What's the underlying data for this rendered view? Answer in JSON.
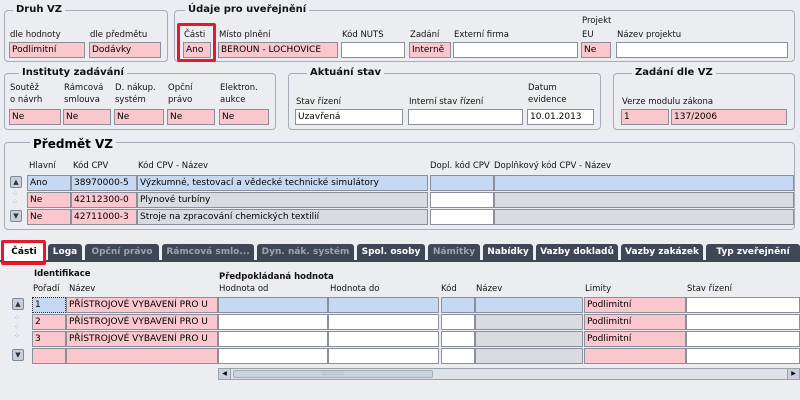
{
  "druh_vz": {
    "title": "Druh VZ",
    "dle_hodnoty_label": "dle hodnoty",
    "dle_hodnoty_value": "Podlimitní",
    "dle_predmetu_label": "dle předmětu",
    "dle_predmetu_value": "Dodávky"
  },
  "udaje": {
    "title": "Údaje pro uveřejnění",
    "casti_label": "Části",
    "casti_value": "Ano",
    "misto_label": "Místo plnění",
    "misto_value": "BEROUN - LOCHOVICE",
    "nuts_label": "Kód NUTS",
    "nuts_value": "",
    "zadani_label": "Zadání",
    "zadani_value": "Interně",
    "externi_label": "Externí firma",
    "externi_value": "",
    "projekt_label_1": "Projekt",
    "projekt_label_2": "EU",
    "projekt_value": "Ne",
    "nazev_label": "Název projektu",
    "nazev_value": ""
  },
  "instituty": {
    "title": "Instituty zadávání",
    "cols": [
      {
        "l1": "Soutěž",
        "l2": "o návrh",
        "value": "Ne"
      },
      {
        "l1": "Rámcová",
        "l2": "smlouva",
        "value": "Ne"
      },
      {
        "l1": "D. nákup.",
        "l2": "systém",
        "value": "Ne"
      },
      {
        "l1": "Opční",
        "l2": "právo",
        "value": "Ne"
      },
      {
        "l1": "Elektron.",
        "l2": "aukce",
        "value": "Ne"
      }
    ]
  },
  "aktualni": {
    "title": "Aktuání stav",
    "stav_label": "Stav řízení",
    "stav_value": "Uzavřená",
    "interni_label": "Interní stav řízení",
    "interni_value": "",
    "datum_label_1": "Datum",
    "datum_label_2": "evidence",
    "datum_value": "10.01.2013"
  },
  "zadani_dle_vz": {
    "title": "Zadání dle VZ",
    "verze_label": "Verze modulu zákona",
    "verze_num": "1",
    "verze_value": "137/2006"
  },
  "predmet": {
    "title": "Předmět VZ",
    "headers": {
      "hlavni": "Hlavní",
      "kod": "Kód CPV",
      "nazev": "Kód CPV - Název",
      "dopl_kod": "Dopl. kód CPV",
      "dopl_nazev": "Doplňkový kód CPV - Název"
    },
    "rows": [
      {
        "hlavni": "Ano",
        "kod": "38970000-5",
        "nazev": "Výzkumné, testovací a vědecké technické simulátory"
      },
      {
        "hlavni": "Ne",
        "kod": "42112300-0",
        "nazev": "Plynové turbíny"
      },
      {
        "hlavni": "Ne",
        "kod": "42711000-3",
        "nazev": "Stroje na zpracování chemických textilií"
      }
    ]
  },
  "tabs": [
    {
      "label": "Části",
      "state": "active"
    },
    {
      "label": "Loga",
      "state": "normal"
    },
    {
      "label": "Opční právo",
      "state": "disabled"
    },
    {
      "label": "Rámcová smlo...",
      "state": "disabled"
    },
    {
      "label": "Dyn. nák. systém",
      "state": "disabled"
    },
    {
      "label": "Spol. osoby",
      "state": "normal"
    },
    {
      "label": "Námitky",
      "state": "disabled"
    },
    {
      "label": "Nabídky",
      "state": "normal"
    },
    {
      "label": "Vazby dokladů",
      "state": "normal"
    },
    {
      "label": "Vazby zakázek",
      "state": "normal"
    },
    {
      "label": "Typ zveřejnění",
      "state": "normal"
    }
  ],
  "casti_table": {
    "identifikace": "Identifikace",
    "predpokladana": "Předpokládaná hodnota",
    "headers": {
      "poradi": "Pořadí",
      "nazev": "Název",
      "hod_od": "Hodnota od",
      "hod_do": "Hodnota do",
      "kod": "Kód",
      "nazev2": "Název",
      "limity": "Limity",
      "stav": "Stav řízení"
    },
    "rows": [
      {
        "poradi": "1",
        "nazev": "PŘÍSTROJOVÉ VYBAVENÍ PRO U",
        "limity": "Podlimitní"
      },
      {
        "poradi": "2",
        "nazev": "PŘÍSTROJOVÉ VYBAVENÍ PRO U",
        "limity": "Podlimitní"
      },
      {
        "poradi": "3",
        "nazev": "PŘÍSTROJOVÉ VYBAVENÍ PRO U",
        "limity": "Podlimitní"
      },
      {
        "poradi": "",
        "nazev": "",
        "limity": ""
      }
    ]
  },
  "colors": {
    "required": "#f9c7cd",
    "highlight": "#c5daf2",
    "tab": "#3f4756",
    "annotation": "#e21a2b"
  }
}
